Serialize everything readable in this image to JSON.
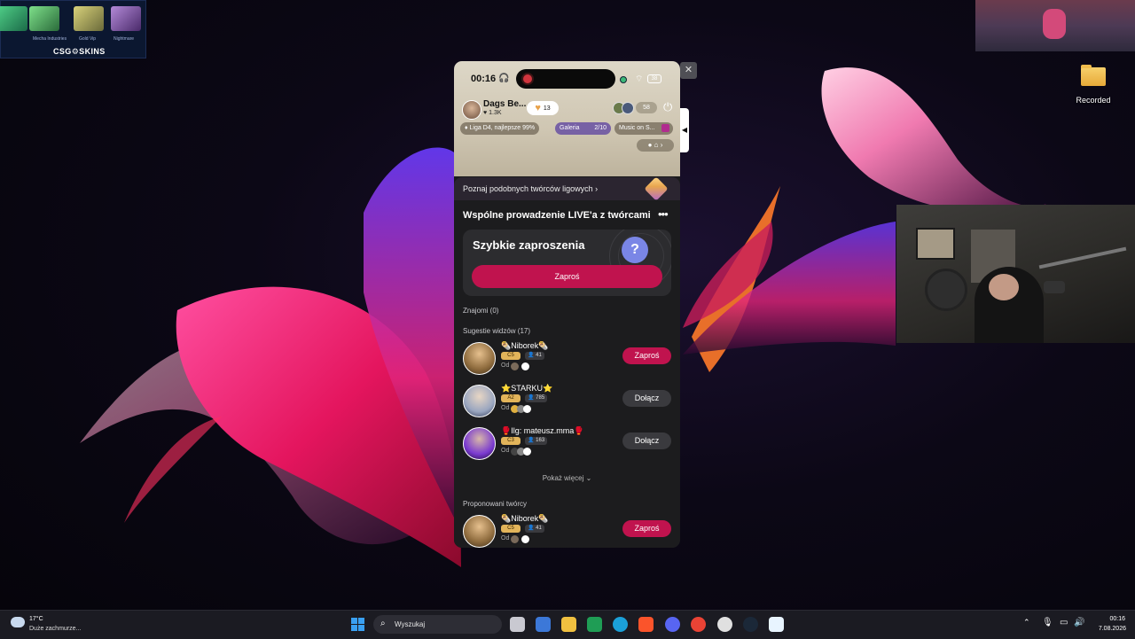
{
  "overlays": {
    "skins": {
      "logo": "CSG⚙SKINS",
      "item_labels": [
        "",
        "Mecha Industries",
        "Gold Vip",
        "Nightmare"
      ]
    },
    "desktop_icon": {
      "label": "Recorded"
    }
  },
  "phone": {
    "status": {
      "time": "00:16",
      "battery": "38"
    },
    "host": {
      "name": "Dags Be...",
      "followers": "1.3K",
      "likes": "13"
    },
    "viewers": {
      "count": "58"
    },
    "chips": {
      "league": "Liga D4, najlepsze 99%",
      "gallery": "Galeria",
      "gallery_count": "2/10",
      "music": "Music on S..."
    },
    "discover": "Poznaj podobnych twórców ligowych",
    "sheet": {
      "title": "Wspólne prowadzenie LIVE'a z twórcami",
      "quick_title": "Szybkie zaproszenia",
      "invite_label": "Zaproś",
      "friends": "Znajomi (0)",
      "suggestions": "Sugestie widzów (17)",
      "show_more": "Pokaż więcej",
      "proposed": "Proponowani twórcy",
      "users": [
        {
          "name": "🌯Niborek🌯",
          "tag": "C5",
          "count": "41",
          "from": "Od",
          "action": "Zaproś"
        },
        {
          "name": "⭐STARKU⭐",
          "tag": "A2",
          "count": "785",
          "from": "Od",
          "action": "Dołącz"
        },
        {
          "name": "🥊Ilg: mateusz.mma🥊",
          "tag": "C3",
          "count": "163",
          "from": "Od",
          "action": "Dołącz"
        }
      ],
      "proposed_users": [
        {
          "name": "🌯Niborek🌯",
          "tag": "C5",
          "count": "41",
          "from": "Od",
          "action": "Zaproś"
        }
      ]
    }
  },
  "taskbar": {
    "weather_temp": "17°C",
    "weather_desc": "Duże zachmurze...",
    "search_placeholder": "Wyszukaj",
    "clock_time": "00:16",
    "clock_date": "7.08.2026"
  },
  "colors": {
    "accent": "#c0134e",
    "gallery_chip": "#5a3fa0"
  }
}
